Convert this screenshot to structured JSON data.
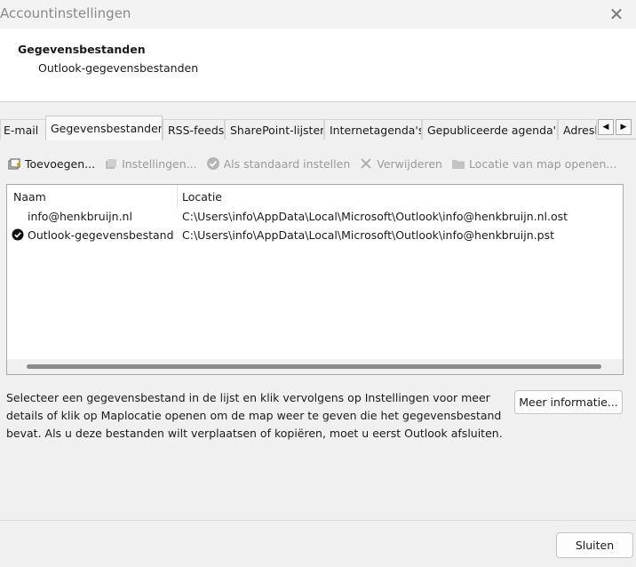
{
  "window": {
    "title": "Accountinstellingen"
  },
  "header": {
    "title": "Gegevensbestanden",
    "subtitle": "Outlook-gegevensbestanden"
  },
  "tabs": [
    {
      "label": "E-mail"
    },
    {
      "label": "Gegevensbestanden",
      "active": true
    },
    {
      "label": "RSS-feeds"
    },
    {
      "label": "SharePoint-lijsten"
    },
    {
      "label": "Internetagenda's"
    },
    {
      "label": "Gepubliceerde agenda's"
    },
    {
      "label": "Adresboeken"
    }
  ],
  "toolbar": {
    "add": "Toevoegen...",
    "settings": "Instellingen...",
    "set_default": "Als standaard instellen",
    "remove": "Verwijderen",
    "open_location": "Locatie van map openen..."
  },
  "list": {
    "columns": [
      "Naam",
      "Locatie"
    ],
    "rows": [
      {
        "name": "info@henkbruijn.nl",
        "location": "C:\\Users\\info\\AppData\\Local\\Microsoft\\Outlook\\info@henkbruijn.nl.ost",
        "default": false
      },
      {
        "name": "Outlook-gegevensbestand",
        "location": "C:\\Users\\info\\AppData\\Local\\Microsoft\\Outlook\\info@henkbruijn.pst",
        "default": true
      }
    ]
  },
  "info": {
    "text": "Selecteer een gegevensbestand in de lijst en klik vervolgens op Instellingen voor meer details of klik op Maplocatie openen om de map weer te geven die het gegevensbestand bevat. Als u deze bestanden wilt verplaatsen of kopiëren, moet u eerst Outlook afsluiten.",
    "more_button": "Meer informatie..."
  },
  "footer": {
    "close_button": "Sluiten"
  }
}
